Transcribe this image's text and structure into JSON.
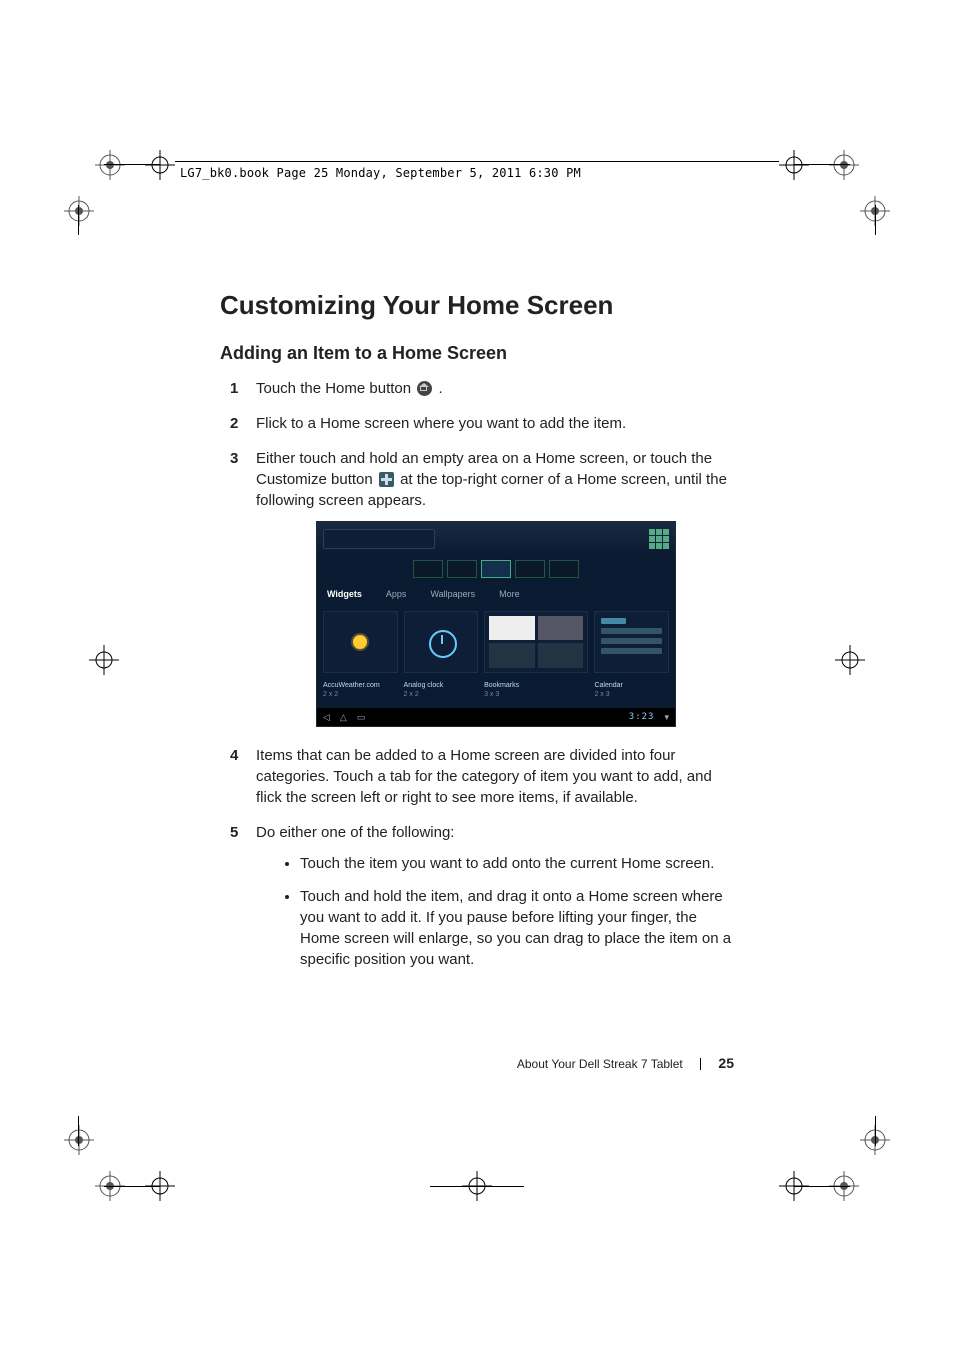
{
  "header": {
    "book_info": "LG7_bk0.book  Page 25  Monday, September 5, 2011  6:30 PM"
  },
  "headings": {
    "h1": "Customizing Your Home Screen",
    "h2": "Adding an Item to a Home Screen"
  },
  "steps": {
    "s1_a": "Touch the Home button ",
    "s1_b": ".",
    "s2": "Flick to a Home screen where you want to add the item.",
    "s3_a": "Either touch and hold an empty area on a Home screen, or touch the Customize button ",
    "s3_b": " at the top-right corner of a Home screen, until the following screen appears.",
    "s4": "Items that can be added to a Home screen are divided into four categories. Touch a tab for the category of item you want to add, and flick the screen left or right to see more items, if available.",
    "s5": "Do either one of the following:",
    "s5_b1": "Touch the item you want to add onto the current Home screen.",
    "s5_b2": "Touch and hold the item, and drag it onto a Home screen where you want to add it. If you pause before lifting your finger, the Home screen will enlarge, so you can drag to place the item on a specific position you want."
  },
  "screenshot": {
    "tabs": {
      "widgets": "Widgets",
      "apps": "Apps",
      "wallpapers": "Wallpapers",
      "more": "More"
    },
    "widgets": {
      "w1_name": "AccuWeather.com",
      "w1_size": "2 x 2",
      "w2_name": "Analog clock",
      "w2_size": "2 x 2",
      "w3_name": "Bookmarks",
      "w3_size": "3 x 3",
      "w4_name": "Calendar",
      "w4_size": "2 x 3"
    },
    "nav_time": "3:23"
  },
  "footer": {
    "section": "About Your Dell Streak 7 Tablet",
    "page": "25"
  }
}
